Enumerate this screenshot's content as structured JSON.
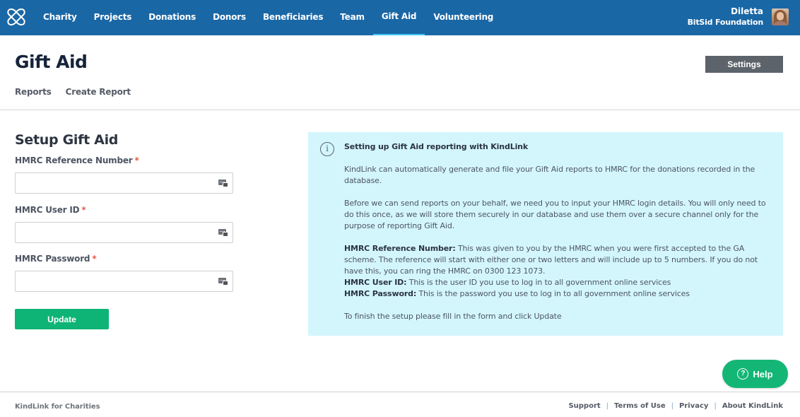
{
  "topbar": {
    "brand_color": "#1a67a6",
    "nav": [
      {
        "label": "Charity",
        "active": false
      },
      {
        "label": "Projects",
        "active": false
      },
      {
        "label": "Donations",
        "active": false
      },
      {
        "label": "Donors",
        "active": false
      },
      {
        "label": "Beneficiaries",
        "active": false
      },
      {
        "label": "Team",
        "active": false
      },
      {
        "label": "Gift Aid",
        "active": true
      },
      {
        "label": "Volunteering",
        "active": false
      }
    ],
    "user": {
      "name": "Diletta",
      "organization": "BitSid Foundation"
    }
  },
  "page": {
    "title": "Gift Aid",
    "settings_label": "Settings",
    "subnav": [
      "Reports",
      "Create Report"
    ]
  },
  "form": {
    "title": "Setup Gift Aid",
    "required_marker": "*",
    "fields": [
      {
        "label": "HMRC Reference Number",
        "value": "",
        "type": "text"
      },
      {
        "label": "HMRC User ID",
        "value": "",
        "type": "text"
      },
      {
        "label": "HMRC Password",
        "value": "",
        "type": "password"
      }
    ],
    "submit_label": "Update",
    "submit_color": "#0db476"
  },
  "info": {
    "background": "#d3f6fd",
    "icon": "info-icon",
    "title": "Setting up Gift Aid reporting with KindLink",
    "paragraph1": "KindLink can automatically generate and file your Gift Aid reports to HMRC for the donations recorded in the database.",
    "paragraph2": "Before we can send reports on your behalf, we need you to input your HMRC login details. You will only need to do this once, as we will store them securely in our database and use them over a secure channel only for the purpose of reporting Gift Aid.",
    "definitions": [
      {
        "term": "HMRC Reference Number:",
        "text": " This was given to you by the HMRC when you were first accepted to the GA scheme. The reference will start with either one or two letters and will include up to 5 numbers. If you do not have this, you can ring the HMRC on 0300 123 1073."
      },
      {
        "term": "HMRC User ID:",
        "text": " This is the user ID you use to log in to all government online services"
      },
      {
        "term": "HMRC Password:",
        "text": " This is the password you use to log in to all government online services"
      }
    ],
    "closing": "To finish the setup please fill in the form and click Update"
  },
  "help": {
    "label": "Help",
    "icon_glyph": "?"
  },
  "footer": {
    "brand": "KindLink for Charities",
    "separator": "|",
    "links": [
      "Support",
      "Terms of Use",
      "Privacy",
      "About KindLink"
    ]
  }
}
